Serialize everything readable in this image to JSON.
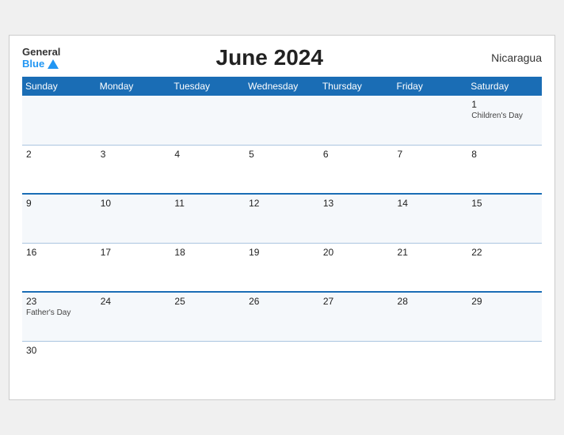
{
  "header": {
    "logo": {
      "general": "General",
      "blue": "Blue"
    },
    "title": "June 2024",
    "country": "Nicaragua"
  },
  "days_of_week": [
    "Sunday",
    "Monday",
    "Tuesday",
    "Wednesday",
    "Thursday",
    "Friday",
    "Saturday"
  ],
  "weeks": [
    [
      {
        "day": "",
        "event": ""
      },
      {
        "day": "",
        "event": ""
      },
      {
        "day": "",
        "event": ""
      },
      {
        "day": "",
        "event": ""
      },
      {
        "day": "",
        "event": ""
      },
      {
        "day": "",
        "event": ""
      },
      {
        "day": "1",
        "event": "Children's Day"
      }
    ],
    [
      {
        "day": "2",
        "event": ""
      },
      {
        "day": "3",
        "event": ""
      },
      {
        "day": "4",
        "event": ""
      },
      {
        "day": "5",
        "event": ""
      },
      {
        "day": "6",
        "event": ""
      },
      {
        "day": "7",
        "event": ""
      },
      {
        "day": "8",
        "event": ""
      }
    ],
    [
      {
        "day": "9",
        "event": ""
      },
      {
        "day": "10",
        "event": ""
      },
      {
        "day": "11",
        "event": ""
      },
      {
        "day": "12",
        "event": ""
      },
      {
        "day": "13",
        "event": ""
      },
      {
        "day": "14",
        "event": ""
      },
      {
        "day": "15",
        "event": ""
      }
    ],
    [
      {
        "day": "16",
        "event": ""
      },
      {
        "day": "17",
        "event": ""
      },
      {
        "day": "18",
        "event": ""
      },
      {
        "day": "19",
        "event": ""
      },
      {
        "day": "20",
        "event": ""
      },
      {
        "day": "21",
        "event": ""
      },
      {
        "day": "22",
        "event": ""
      }
    ],
    [
      {
        "day": "23",
        "event": "Father's Day"
      },
      {
        "day": "24",
        "event": ""
      },
      {
        "day": "25",
        "event": ""
      },
      {
        "day": "26",
        "event": ""
      },
      {
        "day": "27",
        "event": ""
      },
      {
        "day": "28",
        "event": ""
      },
      {
        "day": "29",
        "event": ""
      }
    ],
    [
      {
        "day": "30",
        "event": ""
      },
      {
        "day": "",
        "event": ""
      },
      {
        "day": "",
        "event": ""
      },
      {
        "day": "",
        "event": ""
      },
      {
        "day": "",
        "event": ""
      },
      {
        "day": "",
        "event": ""
      },
      {
        "day": "",
        "event": ""
      }
    ]
  ],
  "blue_border_rows": [
    2,
    4
  ]
}
